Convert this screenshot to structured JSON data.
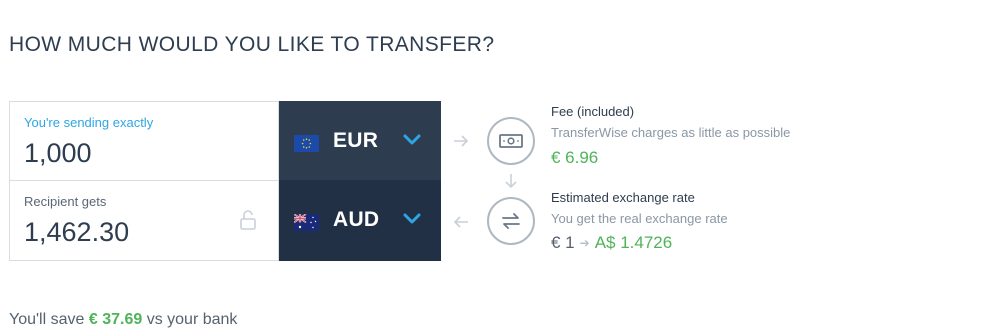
{
  "header": {
    "title": "HOW MUCH WOULD YOU LIKE TO TRANSFER?"
  },
  "send": {
    "label": "You're sending exactly",
    "amount": "1,000",
    "currency": "EUR",
    "flag_icon": "eu-flag-icon"
  },
  "receive": {
    "label": "Recipient gets",
    "amount": "1,462.30",
    "currency": "AUD",
    "flag_icon": "au-flag-icon"
  },
  "fee": {
    "title": "Fee (included)",
    "subtitle": "TransferWise charges as little as possible",
    "value": "€ 6.96"
  },
  "rate": {
    "title": "Estimated exchange rate",
    "subtitle": "You get the real exchange rate",
    "from": "€ 1",
    "to": "A$ 1.4726"
  },
  "savings": {
    "prefix": "You'll save",
    "amount": "€ 37.69",
    "suffix": "vs your bank"
  },
  "colors": {
    "accent_blue": "#2ea6e5",
    "positive_green": "#4fb35a",
    "dark_navy": "#2e3c50"
  }
}
